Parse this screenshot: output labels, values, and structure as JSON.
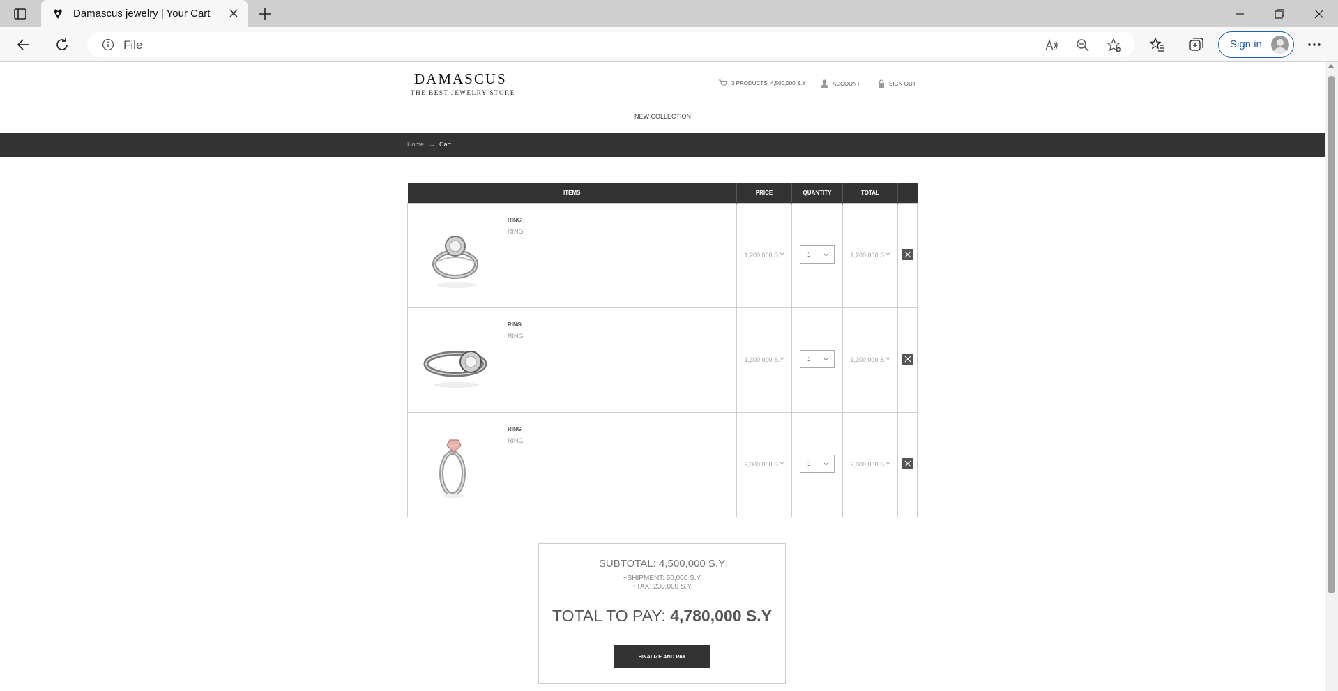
{
  "browser": {
    "tab_title": "Damascus jewelry | Your Cart",
    "url_text": "File",
    "signin_label": "Sign in"
  },
  "site": {
    "logo_text": "DAMASCUS",
    "logo_tagline": "THE BEST JEWELRY STORE",
    "cart_summary": "3 PRODUCTS, 4,500,000 S.Y",
    "account_label": "ACCOUNT",
    "signout_label": "SIGN OUT",
    "nav_collection": "NEW COLLECTION",
    "breadcrumb": {
      "home": "Home",
      "separator": "→",
      "current": "Cart"
    }
  },
  "cart": {
    "headers": {
      "items": "ITEMS",
      "price": "PRICE",
      "quantity": "QUANTITY",
      "total": "TOTAL"
    },
    "rows": [
      {
        "name": "RING",
        "desc": "RING",
        "price": "1,200,000 S.Y",
        "qty": "1",
        "total": "1,200,000 S.Y",
        "image": "ring-halo-icon"
      },
      {
        "name": "RING",
        "desc": "RING",
        "price": "1,300,000 S.Y",
        "qty": "1",
        "total": "1,300,000 S.Y",
        "image": "ring-band-icon"
      },
      {
        "name": "RING",
        "desc": "RING",
        "price": "2,000,000 S.Y",
        "qty": "1",
        "total": "2,000,000 S.Y",
        "image": "ring-pink-icon"
      }
    ]
  },
  "summary": {
    "subtotal": "SUBTOTAL: 4,500,000 S.Y",
    "shipment": "+SHIPMENT: 50,000 S.Y",
    "tax": "+TAX: 230,000 S.Y",
    "total_label": "TOTAL TO PAY:",
    "total_value": "4,780,000 S.Y",
    "pay_button": "FINALIZE AND PAY"
  },
  "colors": {
    "dark_bar": "#333333",
    "signin_blue": "#1f5fa8",
    "pink_gem": "#e8b3ad"
  }
}
